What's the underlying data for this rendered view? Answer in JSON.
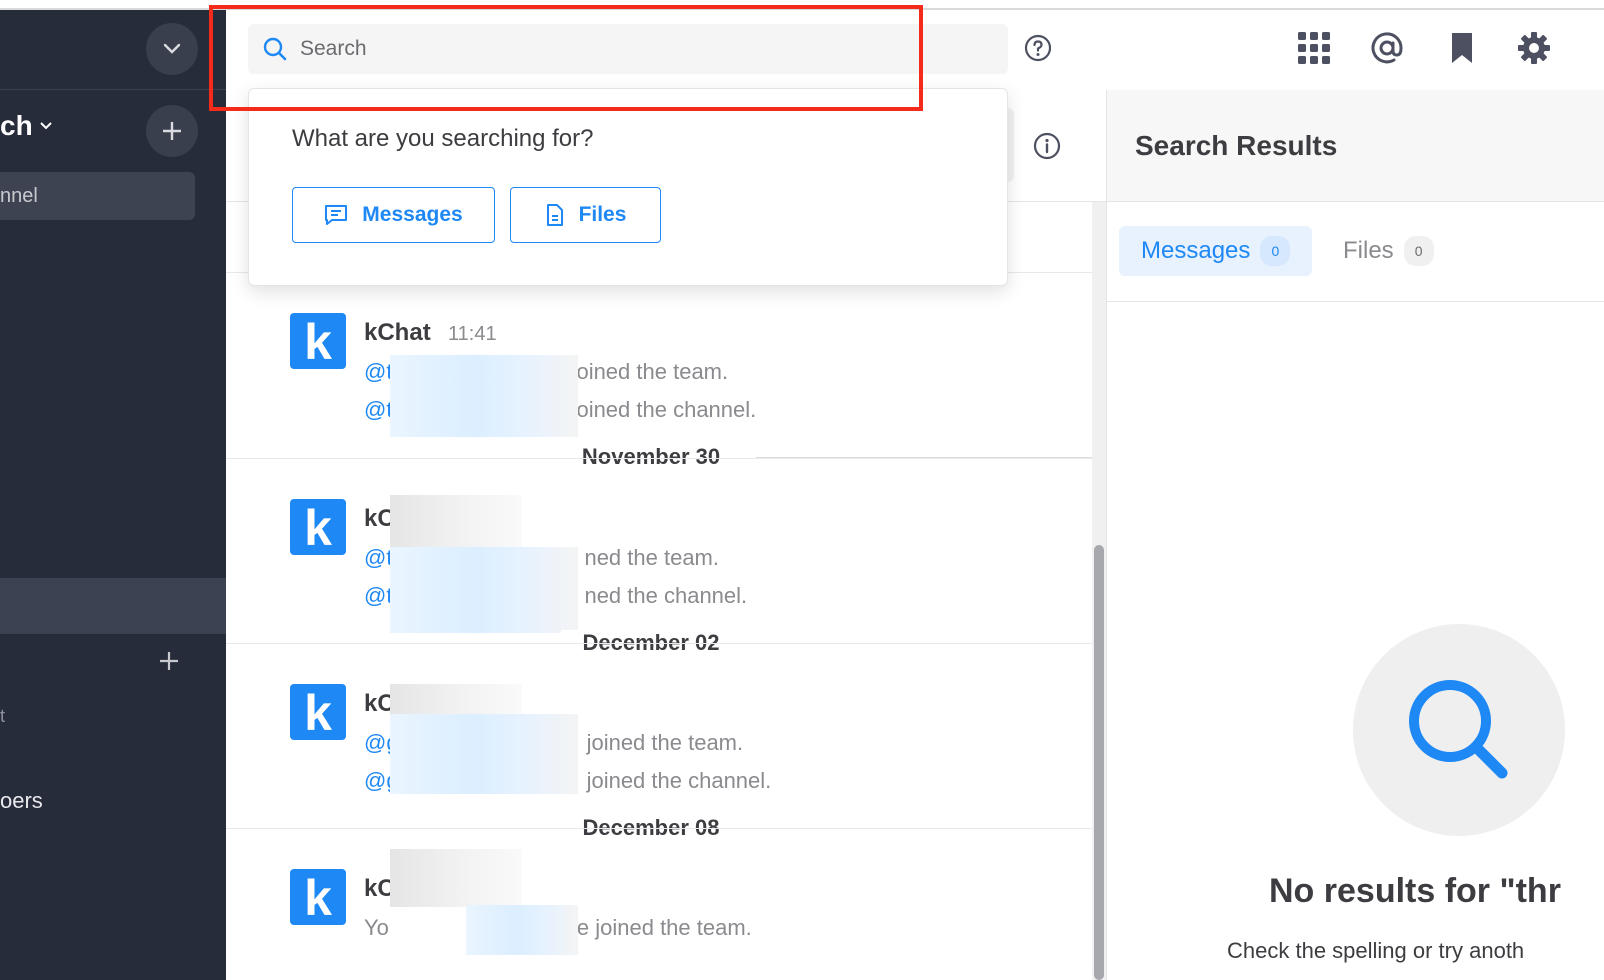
{
  "search": {
    "placeholder": "Search"
  },
  "sidebar": {
    "team_name_fragment": "ch",
    "channel_fragment": "nnel",
    "frag_t": "t",
    "frag_members": "oers"
  },
  "dropdown": {
    "title": "What are you searching for?",
    "messages_label": "Messages",
    "files_label": "Files"
  },
  "posts": [
    {
      "author": "kChat",
      "time": "11:41",
      "line1_at": "@t",
      "line1_rest": "oined the team.",
      "line2_at": "@t",
      "line2_rest": "oined the channel."
    },
    {
      "author_fragment": "kC",
      "line1_at": "@t",
      "line1_rest": "ned the team.",
      "line2_at": "@t",
      "line2_rest": "ned the channel."
    },
    {
      "author_fragment": "kC",
      "line1_at": "@g",
      "line1_rest": "joined the team.",
      "line2_at": "@g",
      "line2_rest": "joined the channel."
    },
    {
      "author_fragment": "kC",
      "line1_at": "Yo",
      "line1_rest": "e joined the team."
    }
  ],
  "date_separators": [
    "November 30",
    "December 02",
    "December 08"
  ],
  "right_panel": {
    "title": "Search Results",
    "tabs": [
      {
        "label": "Messages",
        "count": "0"
      },
      {
        "label": "Files",
        "count": "0"
      }
    ],
    "no_results": "No results for \"thr",
    "hint": "Check the spelling or try anoth"
  },
  "colors": {
    "accent": "#1e88f5",
    "sidebar_bg": "#272c3a",
    "highlight_box": "#f42a1a"
  },
  "icons": {
    "search": "search-icon",
    "help": "help-icon",
    "apps": "apps-grid-icon",
    "mention": "at-mention-icon",
    "bookmark": "bookmark-icon",
    "settings": "gear-icon",
    "info": "info-icon"
  }
}
